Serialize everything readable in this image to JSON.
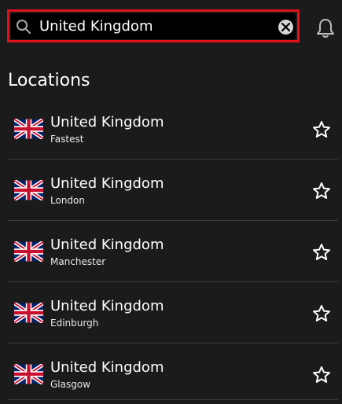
{
  "search": {
    "value": "United Kingdom"
  },
  "section": {
    "title": "Locations"
  },
  "locations": [
    {
      "country": "United Kingdom",
      "city": "Fastest"
    },
    {
      "country": "United Kingdom",
      "city": "London"
    },
    {
      "country": "United Kingdom",
      "city": "Manchester"
    },
    {
      "country": "United Kingdom",
      "city": "Edinburgh"
    },
    {
      "country": "United Kingdom",
      "city": "Glasgow"
    }
  ],
  "icons": {
    "search": "search-icon",
    "clear": "clear-icon",
    "notifications": "bell-icon",
    "flag": "uk-flag-icon",
    "favorite": "star-icon"
  },
  "colors": {
    "background": "#1b1b1b",
    "search_highlight": "#e0121b"
  }
}
